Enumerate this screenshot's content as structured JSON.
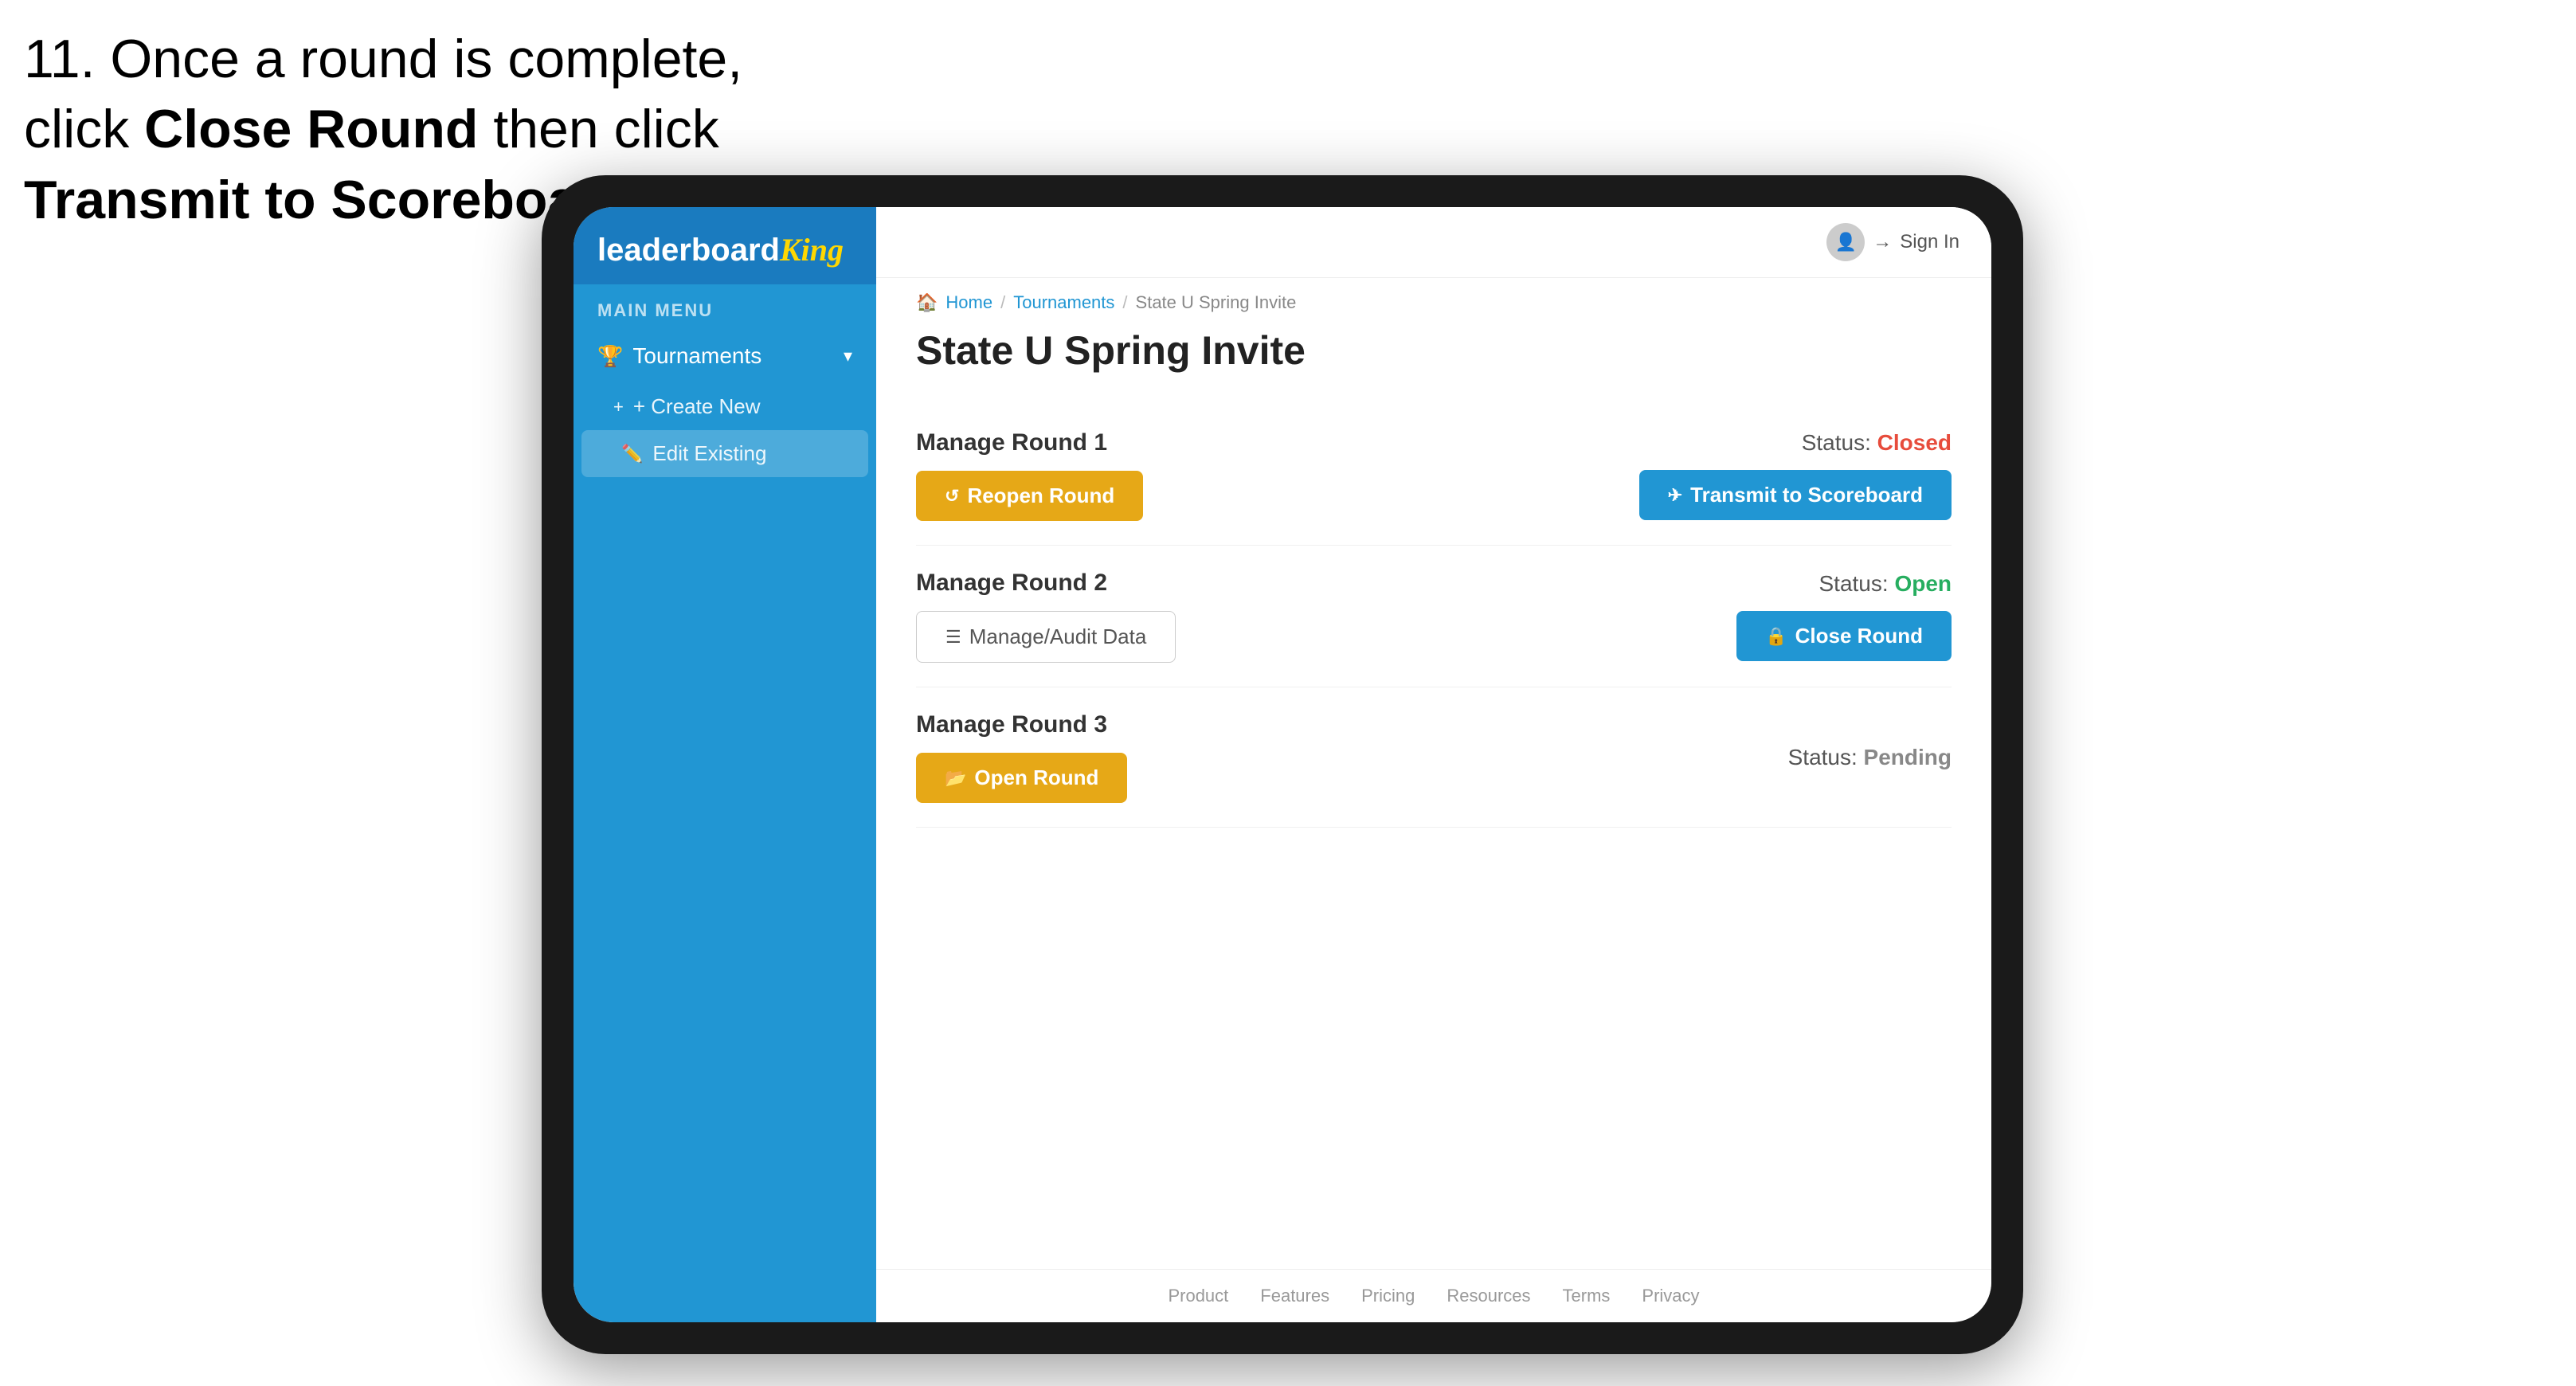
{
  "instruction": {
    "line1": "11. Once a round is complete,",
    "line2": "click ",
    "bold1": "Close Round",
    "line3": " then click",
    "bold2": "Transmit to Scoreboard."
  },
  "header": {
    "sign_in": "Sign In",
    "user_icon": "👤"
  },
  "breadcrumb": {
    "home": "Home",
    "sep1": "/",
    "tournaments": "Tournaments",
    "sep2": "/",
    "current": "State U Spring Invite"
  },
  "page": {
    "title": "State U Spring Invite"
  },
  "sidebar": {
    "logo_main": "leaderboard",
    "logo_king": "King",
    "main_menu": "MAIN MENU",
    "nav_tournaments": "Tournaments",
    "nav_create": "+ Create New",
    "nav_edit": "Edit Existing"
  },
  "rounds": [
    {
      "id": "round1",
      "title": "Manage Round 1",
      "status_label": "Status:",
      "status_value": "Closed",
      "status_class": "status-closed",
      "button_label": "Reopen Round",
      "button_type": "orange",
      "button_icon": "↺",
      "right_button_label": "Transmit to Scoreboard",
      "right_button_type": "blue",
      "right_button_icon": "✈"
    },
    {
      "id": "round2",
      "title": "Manage Round 2",
      "status_label": "Status:",
      "status_value": "Open",
      "status_class": "status-open",
      "button_label": "Manage/Audit Data",
      "button_type": "outline",
      "button_icon": "☰",
      "right_button_label": "Close Round",
      "right_button_type": "blue",
      "right_button_icon": "🔒"
    },
    {
      "id": "round3",
      "title": "Manage Round 3",
      "status_label": "Status:",
      "status_value": "Pending",
      "status_class": "status-pending",
      "button_label": "Open Round",
      "button_type": "orange",
      "button_icon": "📂",
      "right_button_label": null
    }
  ],
  "footer": {
    "links": [
      "Product",
      "Features",
      "Pricing",
      "Resources",
      "Terms",
      "Privacy"
    ]
  }
}
